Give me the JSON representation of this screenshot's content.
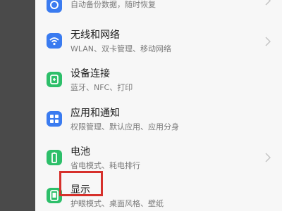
{
  "settings": {
    "items": [
      {
        "id": "backup",
        "title": "",
        "subtitle": "自动备份数据，随时恢复",
        "icon": "backup-icon",
        "color": "#3a7bf0"
      },
      {
        "id": "wireless",
        "title": "无线和网络",
        "subtitle": "WLAN、双卡管理、移动网络",
        "icon": "wifi-icon",
        "color": "#3a7bf0"
      },
      {
        "id": "device",
        "title": "设备连接",
        "subtitle": "蓝牙、NFC、打印",
        "icon": "device-icon",
        "color": "#2dbf6a"
      },
      {
        "id": "apps",
        "title": "应用和通知",
        "subtitle": "权限管理、默认应用、应用分身",
        "icon": "apps-icon",
        "color": "#3a7bf0"
      },
      {
        "id": "battery",
        "title": "电池",
        "subtitle": "省电模式、耗电排行",
        "icon": "battery-icon",
        "color": "#2dbf6a"
      },
      {
        "id": "display",
        "title": "显示",
        "subtitle": "护眼模式、桌面风格、壁纸",
        "icon": "display-icon",
        "color": "#2dbf6a"
      }
    ]
  },
  "annotation": {
    "color": "#d6302b"
  }
}
